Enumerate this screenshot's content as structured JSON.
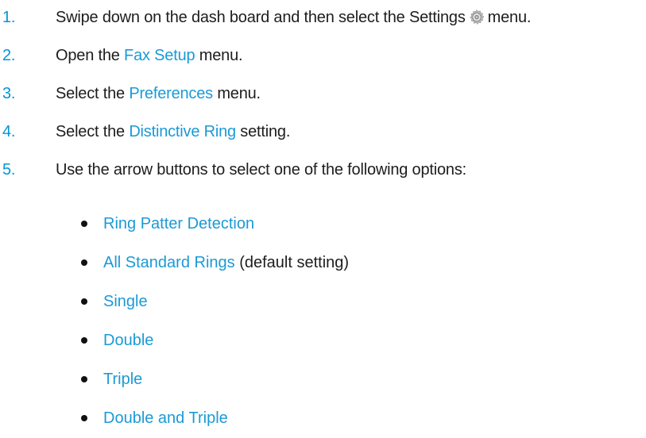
{
  "colors": {
    "number": "#0096d6",
    "link": "#1b9ad6",
    "text": "#1d1d1d"
  },
  "steps": [
    {
      "number": "1.",
      "before": "Swipe down on the dash board and then select the Settings",
      "icon": "gear-icon",
      "after": "menu."
    },
    {
      "number": "2.",
      "before": "Open the",
      "link": "Fax Setup",
      "after": "menu."
    },
    {
      "number": "3.",
      "before": "Select the",
      "link": "Preferences",
      "after": "menu."
    },
    {
      "number": "4.",
      "before": "Select the",
      "link": "Distinctive Ring",
      "after": "setting."
    },
    {
      "number": "5.",
      "before": "Use the arrow buttons to select one of the following options:"
    }
  ],
  "options": [
    {
      "label": "Ring Patter Detection",
      "note": ""
    },
    {
      "label": "All Standard Rings",
      "note": "(default setting)"
    },
    {
      "label": "Single",
      "note": ""
    },
    {
      "label": "Double",
      "note": ""
    },
    {
      "label": "Triple",
      "note": ""
    },
    {
      "label": "Double and Triple",
      "note": ""
    }
  ]
}
